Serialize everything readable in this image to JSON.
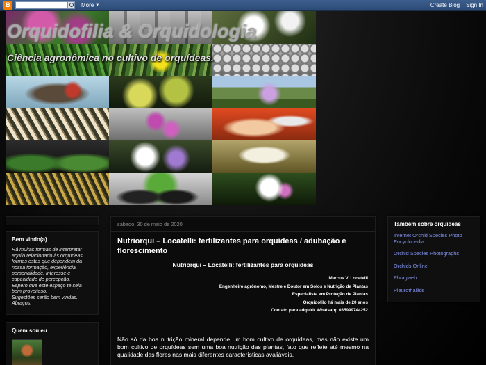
{
  "navbar": {
    "logo": "B",
    "more_label": "More",
    "create_blog": "Create Blog",
    "sign_in": "Sign In"
  },
  "header": {
    "title": "Orquidofilia & Orquidologia",
    "description": "Ciência agronômica no cultivo de orquídeas."
  },
  "sidebar_left": {
    "welcome": {
      "title": "Bem vindo(a)",
      "text": "Há muitas formas de interpretar\naquilo relacionado às orquídeas,\nformas estas que dependem da\nnossa formação, experiência,\npersonalidade, interesse e\ncapacidade de percepção.\nEspero que este espaço te seja\nbem proveitoso.\nSugestões serão bem vindas.\nAbraços."
    },
    "profile": {
      "title": "Quem sou eu"
    }
  },
  "post": {
    "date": "sábado, 30 de maio de 2020",
    "title": "Nutriorqui – Locatelli: fertilizantes para orquídeas / adubação e florescimento",
    "subtitle": "Nutriorqui – Locatelli: fertilizantes para orquídeas",
    "byline": [
      "Marcus V. Locatelli",
      "Engenheiro agrônomo, Mestre e Doutor em Solos e Nutrição de Plantas",
      "Especialista em Proteção de Plantas",
      "Orquidófilo há mais de 20 anos",
      "Contato para adquirir Whatsapp 035999744252"
    ],
    "body": "Não só da boa nutrição mineral depende um bom cultivo de orquídeas, mas não existe um bom cultivo de orquídeas sem uma boa nutrição das plantas, fato que reflete até mesmo na qualidade das flores nas mais diferentes características avaliáveis."
  },
  "sidebar_right": {
    "title": "Também sobre orquídeas",
    "links": [
      "Internet Orchid Species Photo Encyclopedia",
      "Orchid Species Photographs",
      "Orchids Online",
      "Phragweb",
      "Pleurothallids"
    ]
  },
  "colors": {
    "navbar": "#2b4a76",
    "link": "#7f8fe8",
    "background": "#000000"
  }
}
